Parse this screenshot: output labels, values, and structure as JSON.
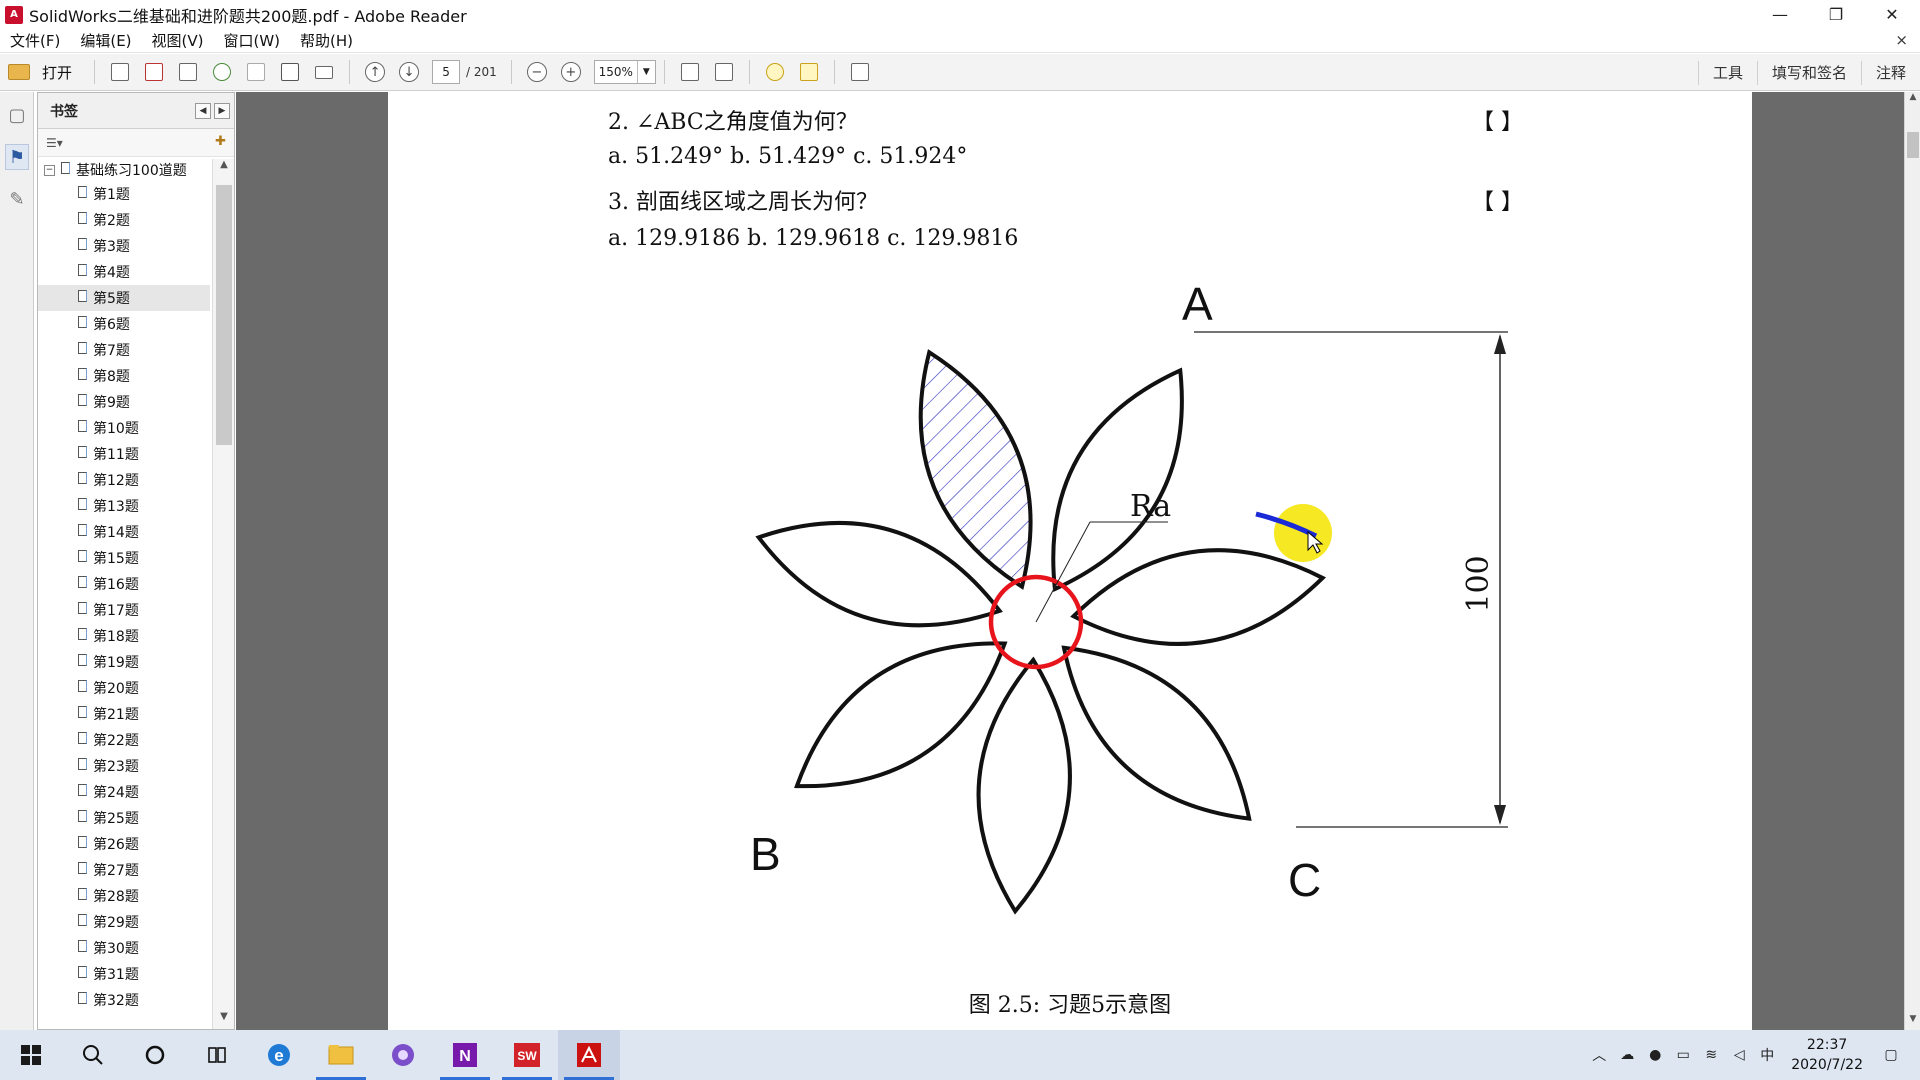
{
  "window": {
    "title": "SolidWorks二维基础和进阶题共200题.pdf - Adobe Reader",
    "app_icon": "adobe-reader-icon",
    "controls": {
      "minimize": "—",
      "restore": "❐",
      "close": "✕"
    }
  },
  "menu": {
    "items": [
      "文件(F)",
      "编辑(E)",
      "视图(V)",
      "窗口(W)",
      "帮助(H)"
    ],
    "close_glyph": "×"
  },
  "toolbar": {
    "open_label": "打开",
    "page_current": "5",
    "page_total": "/ 201",
    "zoom": "150%",
    "right": [
      "工具",
      "填写和签名",
      "注释"
    ]
  },
  "bookmarks": {
    "header": "书签",
    "root_label": "基础练习100道题",
    "items": [
      "第1题",
      "第2题",
      "第3题",
      "第4题",
      "第5题",
      "第6题",
      "第7题",
      "第8题",
      "第9题",
      "第10题",
      "第11题",
      "第12题",
      "第13题",
      "第14题",
      "第15题",
      "第16题",
      "第17题",
      "第18题",
      "第19题",
      "第20题",
      "第21题",
      "第22题",
      "第23题",
      "第24题",
      "第25题",
      "第26题",
      "第27题",
      "第28题",
      "第29题",
      "第30题",
      "第31题",
      "第32题"
    ],
    "selected": "第5题"
  },
  "document": {
    "q2": "2. ∠ABC之角度值为何？",
    "q2_options": "a. 51.249°  b. 51.429°  c. 51.924°",
    "q3": "3. 剖面线区域之周长为何？",
    "q3_options": "a. 129.9186  b. 129.9618  c. 129.9816",
    "bracket": "【    】",
    "figure": {
      "label_a": "A",
      "label_b": "B",
      "label_c": "C",
      "label_ra": "Ra",
      "dimension": "100",
      "caption": "图 2.5: 习题5示意图"
    },
    "colors": {
      "circle": "#e8141c",
      "hatch": "#2b2bbf",
      "highlight": "#f5e60a",
      "arc_highlight": "#1a2ad6"
    }
  },
  "taskbar": {
    "apps": [
      "windows-start-icon",
      "search-icon",
      "cortana-icon",
      "task-view-icon",
      "edge-icon",
      "file-explorer-icon",
      "media-icon",
      "onenote-icon",
      "solidworks-icon",
      "adobe-reader-icon"
    ],
    "tray_lang": "中",
    "time": "22:37",
    "date": "2020/7/22"
  }
}
